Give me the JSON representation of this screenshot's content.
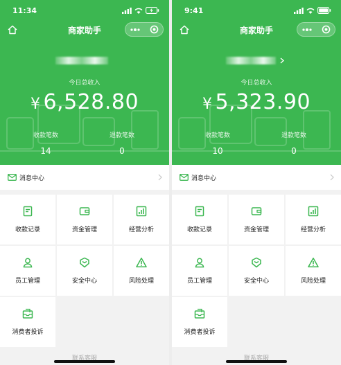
{
  "colors": {
    "brand": "#3cb751",
    "text": "#222222"
  },
  "screens": [
    {
      "status_time": "11:34",
      "title": "商家助手",
      "income_label": "今日总收入",
      "currency": "¥",
      "income": "6,528.80",
      "stats": [
        {
          "label": "收款笔数",
          "value": "14"
        },
        {
          "label": "退款笔数",
          "value": "0"
        }
      ],
      "message_center": "消息中心",
      "menu": [
        {
          "label": "收款记录",
          "icon": "receipt-icon"
        },
        {
          "label": "资金管理",
          "icon": "wallet-icon"
        },
        {
          "label": "经营分析",
          "icon": "chart-icon"
        },
        {
          "label": "员工管理",
          "icon": "staff-icon"
        },
        {
          "label": "安全中心",
          "icon": "shield-icon"
        },
        {
          "label": "风险处理",
          "icon": "warning-icon"
        },
        {
          "label": "消费者投诉",
          "icon": "complaint-icon"
        }
      ],
      "footer": "联系客服"
    },
    {
      "status_time": "9:41",
      "title": "商家助手",
      "income_label": "今日总收入",
      "currency": "¥",
      "income": "5,323.90",
      "stats": [
        {
          "label": "收款笔数",
          "value": "10"
        },
        {
          "label": "退款笔数",
          "value": "0"
        }
      ],
      "message_center": "消息中心",
      "menu": [
        {
          "label": "收款记录",
          "icon": "receipt-icon"
        },
        {
          "label": "资金管理",
          "icon": "wallet-icon"
        },
        {
          "label": "经营分析",
          "icon": "chart-icon"
        },
        {
          "label": "员工管理",
          "icon": "staff-icon"
        },
        {
          "label": "安全中心",
          "icon": "shield-icon"
        },
        {
          "label": "风险处理",
          "icon": "warning-icon"
        },
        {
          "label": "消费者投诉",
          "icon": "complaint-icon"
        }
      ],
      "footer": "联系客服"
    }
  ]
}
